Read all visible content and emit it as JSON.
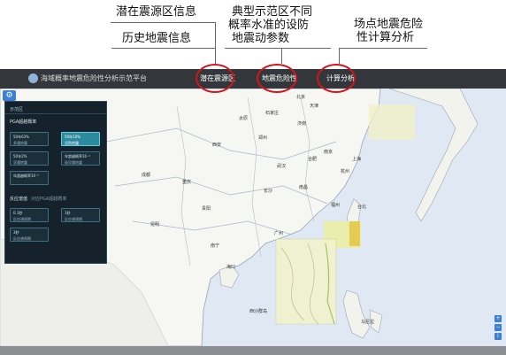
{
  "annotations": {
    "source_zone_info": "潜在震源区信息",
    "historical_eq_info": "历史地震信息",
    "typical_demo_lines": [
      "典型示范区不同",
      "概率水准的设防",
      "地震动参数"
    ],
    "site_hazard_lines": [
      "场点地震危险",
      "性计算分析"
    ]
  },
  "app": {
    "title": "海域概率地震危险性分析示范平台",
    "nav": {
      "tab1": "潜在震源区",
      "tab2": "地震危险性",
      "tab3": "计算分析"
    },
    "highlight_color": "#d3141c"
  },
  "panel": {
    "title": "示范区",
    "pga_section": "PGA超越概率",
    "pga_cards": [
      {
        "line1": "50年63%",
        "line2": "多遇地震"
      },
      {
        "line1": "50年10%",
        "line2": "设防地震"
      },
      {
        "line1": "50年2%",
        "line2": "罕遇地震"
      },
      {
        "line1": "年超越概率10⁻⁴",
        "line2": "极罕遇地震"
      },
      {
        "line1": "年超越概率10⁻⁵",
        "line2": ""
      }
    ],
    "period_section": "反应谱值",
    "period_sub": "对应PGA超越概率",
    "period_cards": [
      {
        "line1": "0.1秒",
        "line2": "反应谱周期"
      },
      {
        "line1": "1秒",
        "line2": "反应谱周期"
      },
      {
        "line1": "3秒",
        "line2": "反应谱周期"
      }
    ]
  },
  "map": {
    "cities": [
      "北京",
      "天津",
      "石家庄",
      "太原",
      "济南",
      "郑州",
      "西安",
      "武汉",
      "南京",
      "上海",
      "杭州",
      "合肥",
      "长沙",
      "南昌",
      "福州",
      "台北",
      "广州",
      "南宁",
      "海口",
      "贵阳",
      "重庆",
      "成都",
      "昆明",
      "马尼拉",
      "西沙群岛"
    ],
    "water_color": "#dfe8f3",
    "land_color": "#f6f6f2"
  },
  "controls": [
    "+",
    "−",
    "i"
  ]
}
